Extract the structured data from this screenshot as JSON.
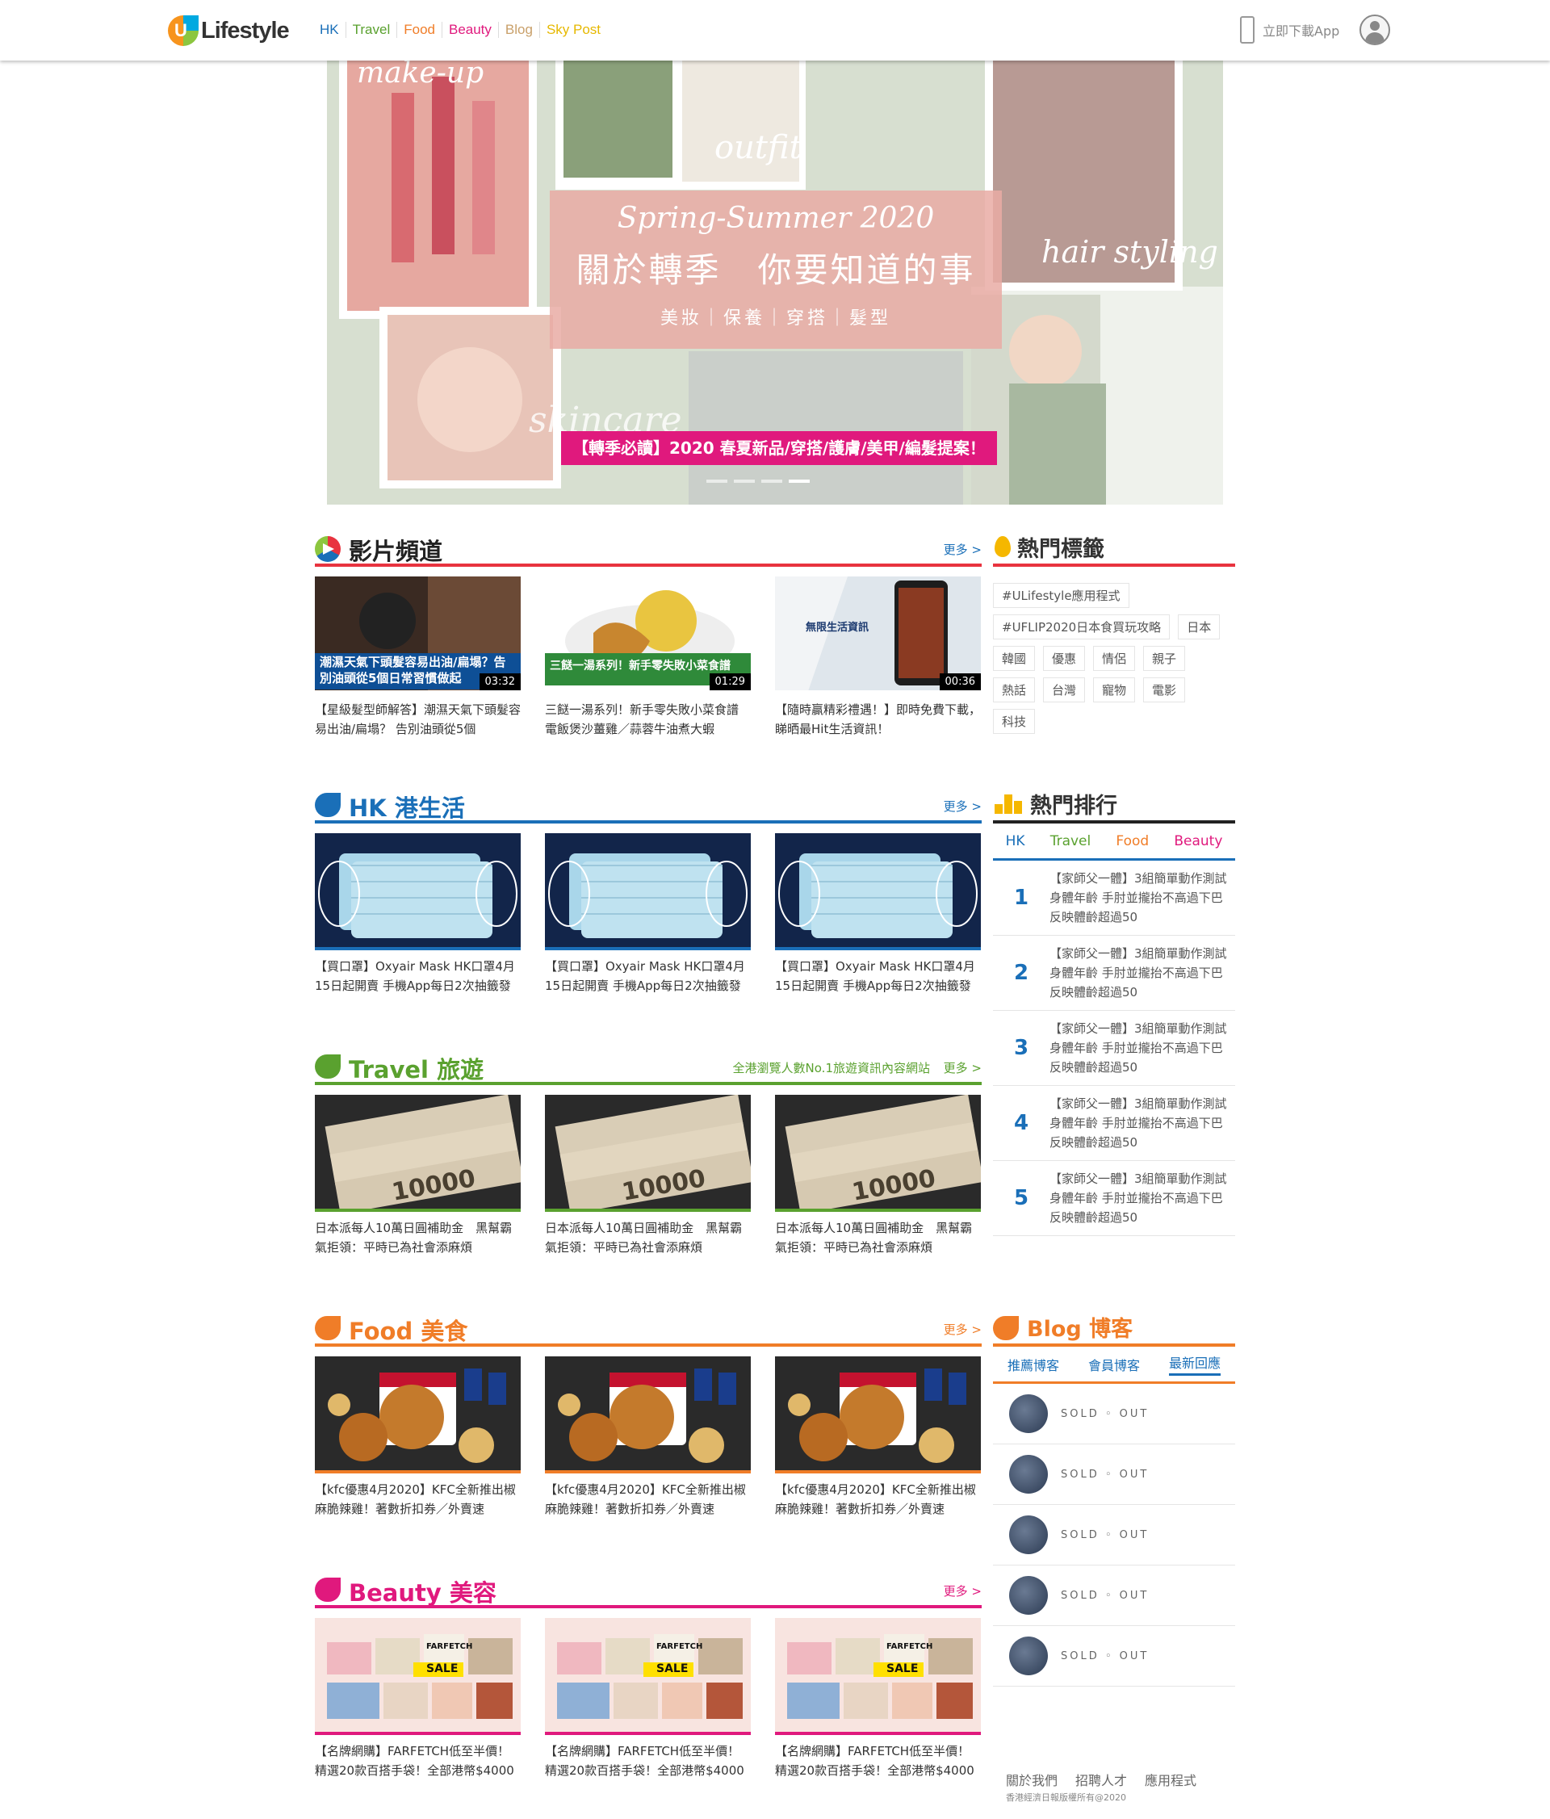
{
  "brand": {
    "logo_letter": "U",
    "logo_text": "Lifestyle"
  },
  "nav": [
    {
      "label": "HK",
      "color": "#1a6fb8"
    },
    {
      "label": "Travel",
      "color": "#5aa12f"
    },
    {
      "label": "Food",
      "color": "#f07d28"
    },
    {
      "label": "Beauty",
      "color": "#e0197d"
    },
    {
      "label": "Blog",
      "color": "#c9a06a"
    },
    {
      "label": "Sky Post",
      "color": "#e6b800"
    }
  ],
  "download": {
    "label": "立即下載App"
  },
  "banner": {
    "labels": {
      "makeup": "make-up",
      "outfit": "outfit",
      "hair": "hair styling",
      "skincare": "skincare"
    },
    "line1": "Spring-Summer 2020",
    "line2": "關於轉季　你要知道的事",
    "line3": "美妝｜保養｜穿搭｜髮型",
    "caption": "【轉季必讀】2020 春夏新品/穿搭/護膚/美甲/編髮提案！"
  },
  "sections": {
    "video": {
      "title": "影片頻道",
      "more": "更多 >",
      "color": "#e8333f",
      "cards": [
        {
          "caption": "【星級髮型師解答】潮濕天氣下頭髮容易出油/扁塌？ 告別油頭從5個",
          "duration": "03:32",
          "thumb_text": "潮濕天氣下頭髮容易出油/扁塌？告別油頭從5個日常習慣做起"
        },
        {
          "caption": "三餸一湯系列！新手零失敗小菜食譜 電飯煲沙薑雞／蒜蓉牛油煮大蝦",
          "duration": "01:29",
          "thumb_text": "三餸一湯系列！新手零失敗小菜食譜"
        },
        {
          "caption": "【隨時贏精彩禮遇！】即時免費下載，睇晒最Hit生活資訊！",
          "duration": "00:36",
          "thumb_text": "無限生活資訊"
        }
      ]
    },
    "hk": {
      "title": "HK 港生活",
      "more": "更多 >",
      "color": "#1a6fb8",
      "cards": [
        {
          "caption": "【買口罩】Oxyair Mask HK口罩4月15日起開賣 手機App每日2次抽籤發"
        },
        {
          "caption": "【買口罩】Oxyair Mask HK口罩4月15日起開賣 手機App每日2次抽籤發"
        },
        {
          "caption": "【買口罩】Oxyair Mask HK口罩4月15日起開賣 手機App每日2次抽籤發"
        }
      ]
    },
    "travel": {
      "title": "Travel 旅遊",
      "sub": "全港瀏覽人數No.1旅遊資訊內容網站",
      "more": "更多 >",
      "color": "#5aa12f",
      "cards": [
        {
          "caption": "日本派每人10萬日圓補助金　黑幫霸氣拒領：平時已為社會添麻煩"
        },
        {
          "caption": "日本派每人10萬日圓補助金　黑幫霸氣拒領：平時已為社會添麻煩"
        },
        {
          "caption": "日本派每人10萬日圓補助金　黑幫霸氣拒領：平時已為社會添麻煩"
        }
      ]
    },
    "food": {
      "title": "Food 美食",
      "more": "更多 >",
      "color": "#f07d28",
      "cards": [
        {
          "caption": "【kfc優惠4月2020】KFC全新推出椒麻脆辣雞！著數折扣券／外賣速"
        },
        {
          "caption": "【kfc優惠4月2020】KFC全新推出椒麻脆辣雞！著數折扣券／外賣速"
        },
        {
          "caption": "【kfc優惠4月2020】KFC全新推出椒麻脆辣雞！著數折扣券／外賣速"
        }
      ]
    },
    "beauty": {
      "title": "Beauty 美容",
      "more": "更多 >",
      "color": "#e0197d",
      "cards": [
        {
          "caption": "【名牌網購】FARFETCH低至半價！精選20款百搭手袋！全部港幣$4000"
        },
        {
          "caption": "【名牌網購】FARFETCH低至半價！精選20款百搭手袋！全部港幣$4000"
        },
        {
          "caption": "【名牌網購】FARFETCH低至半價！精選20款百搭手袋！全部港幣$4000"
        }
      ]
    }
  },
  "thumb_labels": {
    "farfetch": "FARFETCH",
    "sale": "SALE",
    "bill": "10000"
  },
  "hot_tags": {
    "title": "熱門標籤",
    "tags": [
      "#ULifestyle應用程式",
      "#UFLIP2020日本食買玩攻略",
      "日本",
      "韓國",
      "優惠",
      "情侶",
      "親子",
      "熱話",
      "台灣",
      "寵物",
      "電影",
      "科技"
    ]
  },
  "ranking": {
    "title": "熱門排行",
    "tabs": [
      {
        "label": "HK",
        "color": "#1a6fb8"
      },
      {
        "label": "Travel",
        "color": "#5aa12f"
      },
      {
        "label": "Food",
        "color": "#f07d28"
      },
      {
        "label": "Beauty",
        "color": "#e0197d"
      }
    ],
    "items": [
      {
        "num": "1",
        "text": "【家師父一體】3組簡單動作測試身體年齡 手肘並攏抬不高過下巴反映體齡超過50"
      },
      {
        "num": "2",
        "text": "【家師父一體】3組簡單動作測試身體年齡 手肘並攏抬不高過下巴反映體齡超過50"
      },
      {
        "num": "3",
        "text": "【家師父一體】3組簡單動作測試身體年齡 手肘並攏抬不高過下巴反映體齡超過50"
      },
      {
        "num": "4",
        "text": "【家師父一體】3組簡單動作測試身體年齡 手肘並攏抬不高過下巴反映體齡超過50"
      },
      {
        "num": "5",
        "text": "【家師父一體】3組簡單動作測試身體年齡 手肘並攏抬不高過下巴反映體齡超過50"
      }
    ]
  },
  "blog": {
    "title": "Blog 博客",
    "color": "#f07d28",
    "tabs": [
      "推薦博客",
      "會員博客",
      "最新回應"
    ],
    "items": [
      {
        "name": "SOLD ◦ OUT"
      },
      {
        "name": "SOLD ◦ OUT"
      },
      {
        "name": "SOLD ◦ OUT"
      },
      {
        "name": "SOLD ◦ OUT"
      },
      {
        "name": "SOLD ◦ OUT"
      }
    ]
  },
  "footer": {
    "links": [
      "關於我們",
      "招聘人才",
      "應用程式"
    ],
    "copyright": "香港經濟日報版權所有@2020"
  }
}
